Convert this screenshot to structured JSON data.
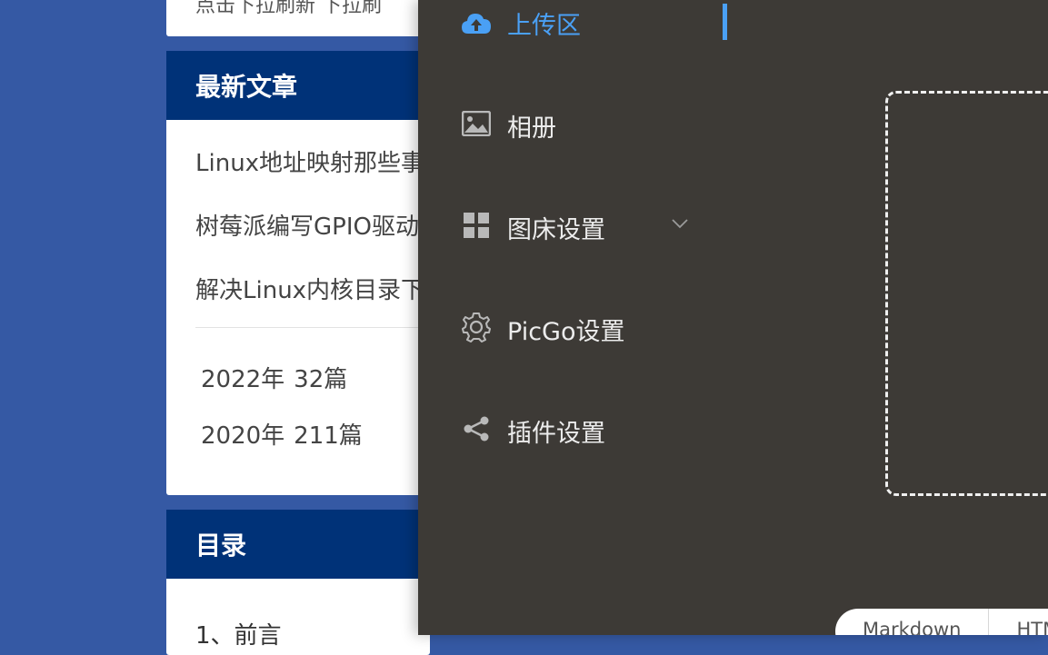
{
  "blog": {
    "top_card_text": "点击下拉刷新 下拉刷",
    "recent": {
      "title": "最新文章",
      "articles": [
        "Linux地址映射那些事",
        "树莓派编写GPIO驱动",
        "解决Linux内核目录下"
      ]
    },
    "archives": [
      {
        "year": "2022年",
        "count": "32篇"
      },
      {
        "year": "2020年",
        "count": "211篇"
      }
    ],
    "toc": {
      "title": "目录",
      "first_item": "1、前言"
    }
  },
  "picgo": {
    "menu": [
      {
        "label": "上传区",
        "icon": "cloud-upload-icon",
        "active": true
      },
      {
        "label": "相册",
        "icon": "picture-icon",
        "active": false
      },
      {
        "label": "图床设置",
        "icon": "grid-icon",
        "active": false,
        "expandable": true
      },
      {
        "label": "PicGo设置",
        "icon": "gear-icon",
        "active": false
      },
      {
        "label": "插件设置",
        "icon": "share-icon",
        "active": false
      }
    ],
    "link_formats": [
      "Markdown",
      "HTML"
    ],
    "colors": {
      "panel_bg": "#3d3a36",
      "active": "#4aa0f5",
      "page_bg": "#3559a4",
      "card_header": "#003278"
    }
  }
}
